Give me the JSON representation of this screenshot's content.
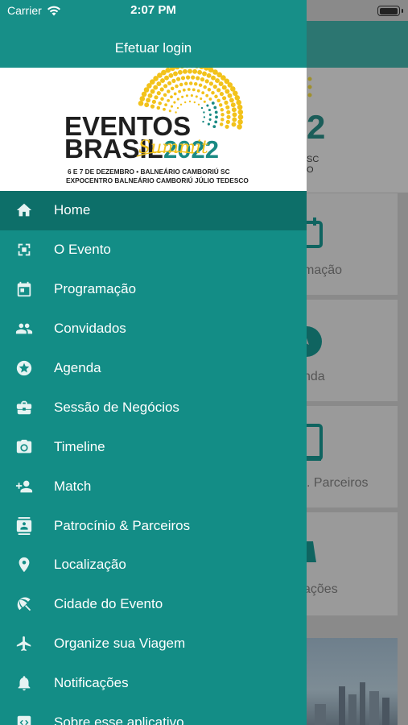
{
  "status_bar": {
    "carrier": "Carrier",
    "time": "2:07 PM"
  },
  "drawer": {
    "login_label": "Efetuar login",
    "banner": {
      "title_line1": "EVENTOS",
      "title_line2": "BRASIL",
      "year": "2022",
      "script": "Summit",
      "date_line": "6 E 7 DE DEZEMBRO  •  BALNEÁRIO CAMBORIÚ SC",
      "venue_line": "EXPOCENTRO BALNEÁRIO CAMBORIÚ JÚLIO TEDESCO"
    },
    "items": [
      {
        "label": "Home",
        "icon": "home-icon"
      },
      {
        "label": "O Evento",
        "icon": "event-icon"
      },
      {
        "label": "Programação",
        "icon": "calendar-icon"
      },
      {
        "label": "Convidados",
        "icon": "people-icon"
      },
      {
        "label": "Agenda",
        "icon": "star-icon"
      },
      {
        "label": "Sessão de Negócios",
        "icon": "briefcase-icon"
      },
      {
        "label": "Timeline",
        "icon": "camera-icon"
      },
      {
        "label": "Match",
        "icon": "match-icon"
      },
      {
        "label": "Patrocínio & Parceiros",
        "icon": "contact-icon"
      },
      {
        "label": "Localização",
        "icon": "location-icon"
      },
      {
        "label": "Cidade do Evento",
        "icon": "beach-icon"
      },
      {
        "label": "Organize sua Viagem",
        "icon": "airplane-icon"
      },
      {
        "label": "Notificações",
        "icon": "bell-icon"
      },
      {
        "label": "Sobre esse aplicativo",
        "icon": "code-icon"
      }
    ],
    "active_index": 0
  },
  "background": {
    "card1_label": "mação",
    "card2_label": "nda",
    "card3_label": "Parceiros",
    "card4_label": "ações"
  },
  "colors": {
    "drawer": "#138d86",
    "active": "#0d6f69",
    "accent_yellow": "#f2c21b",
    "brand_teal": "#1a8a83"
  }
}
